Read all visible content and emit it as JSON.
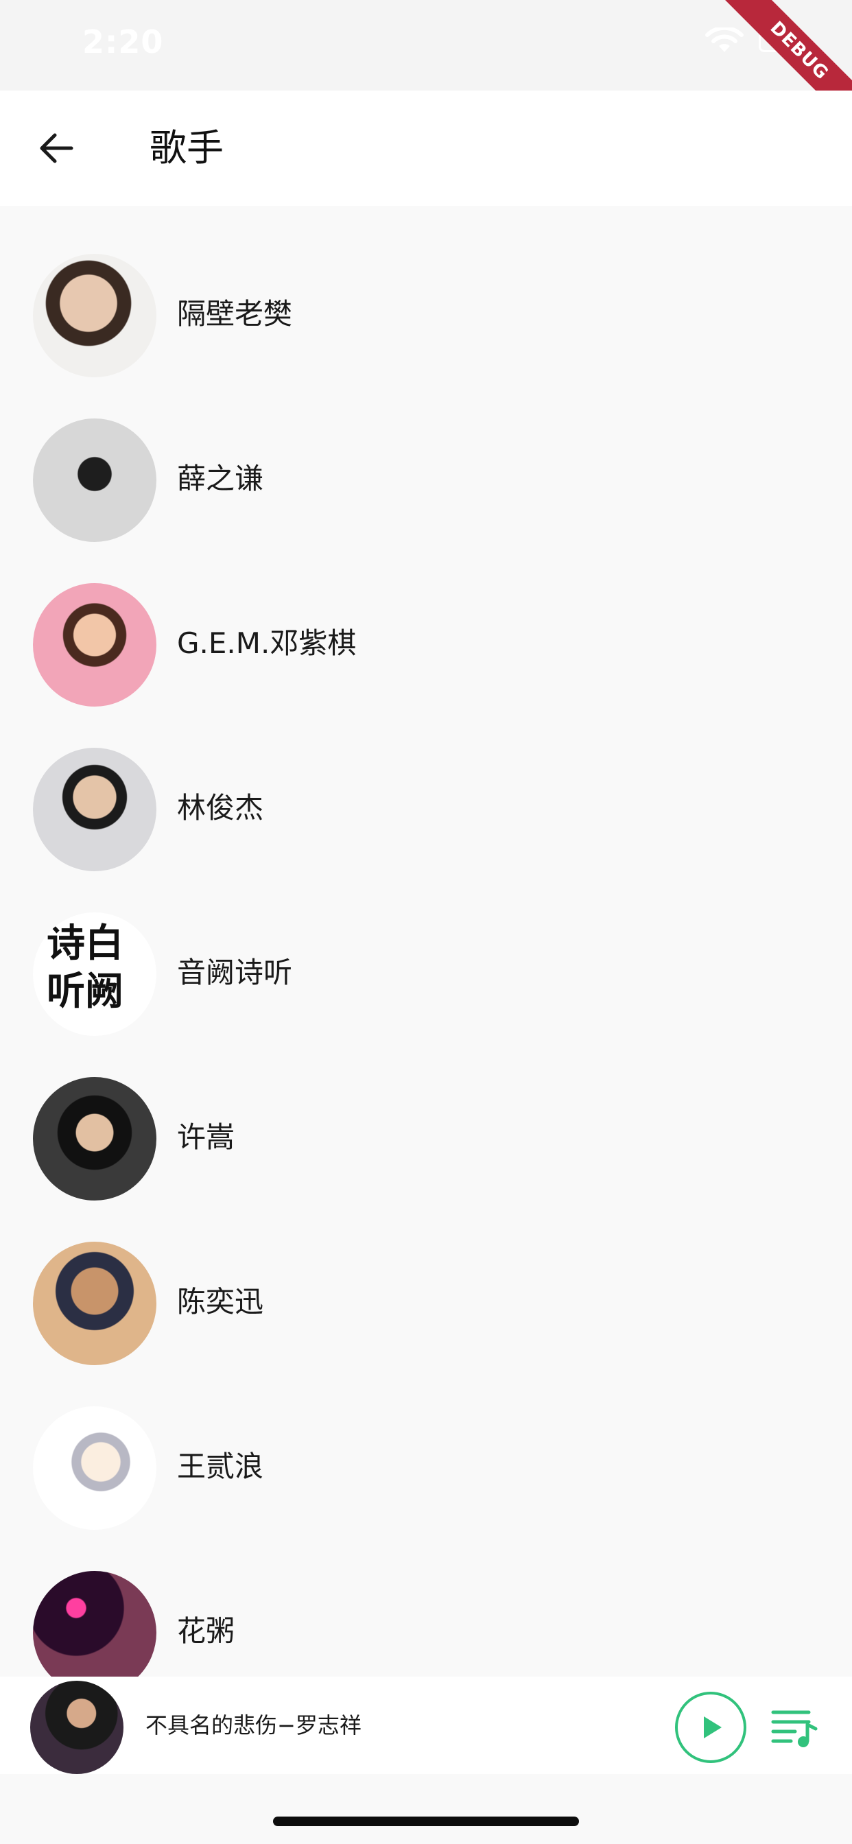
{
  "status_bar": {
    "time": "2:20",
    "debug_banner": "DEBUG"
  },
  "header": {
    "title": "歌手",
    "back_icon": "arrow-left-icon"
  },
  "artists": [
    {
      "name": "隔壁老樊"
    },
    {
      "name": "薛之谦"
    },
    {
      "name": "G.E.M.邓紫棋"
    },
    {
      "name": "林俊杰"
    },
    {
      "name": "音阙诗听",
      "avatar_text": [
        "诗",
        "白",
        "听",
        "阙"
      ]
    },
    {
      "name": "许嵩"
    },
    {
      "name": "陈奕迅"
    },
    {
      "name": "王贰浪"
    },
    {
      "name": "花粥"
    }
  ],
  "mini_player": {
    "now_playing": "不具名的悲伤−罗志祥",
    "play_icon": "play-icon",
    "playlist_icon": "playlist-icon",
    "accent_color": "#31c27c"
  },
  "colors": {
    "background": "#f9f9f9",
    "app_bar": "#ffffff",
    "debug_ribbon": "#b8283b"
  }
}
